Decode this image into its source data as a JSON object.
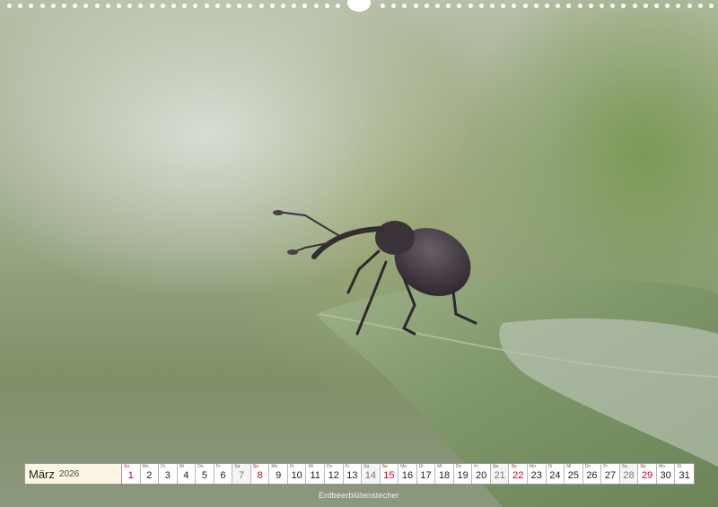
{
  "calendar": {
    "month": "März",
    "year": "2026",
    "days": [
      {
        "dow": "So",
        "num": "1",
        "type": "sun"
      },
      {
        "dow": "Mo",
        "num": "2",
        "type": "work"
      },
      {
        "dow": "Di",
        "num": "3",
        "type": "work"
      },
      {
        "dow": "Mi",
        "num": "4",
        "type": "work"
      },
      {
        "dow": "Do",
        "num": "5",
        "type": "work"
      },
      {
        "dow": "Fr",
        "num": "6",
        "type": "work"
      },
      {
        "dow": "Sa",
        "num": "7",
        "type": "sat"
      },
      {
        "dow": "So",
        "num": "8",
        "type": "sun"
      },
      {
        "dow": "Mo",
        "num": "9",
        "type": "work"
      },
      {
        "dow": "Di",
        "num": "10",
        "type": "work"
      },
      {
        "dow": "Mi",
        "num": "11",
        "type": "work"
      },
      {
        "dow": "Do",
        "num": "12",
        "type": "work"
      },
      {
        "dow": "Fr",
        "num": "13",
        "type": "work"
      },
      {
        "dow": "Sa",
        "num": "14",
        "type": "sat"
      },
      {
        "dow": "So",
        "num": "15",
        "type": "sun"
      },
      {
        "dow": "Mo",
        "num": "16",
        "type": "work"
      },
      {
        "dow": "Di",
        "num": "17",
        "type": "work"
      },
      {
        "dow": "Mi",
        "num": "18",
        "type": "work"
      },
      {
        "dow": "Do",
        "num": "19",
        "type": "work"
      },
      {
        "dow": "Fr",
        "num": "20",
        "type": "work"
      },
      {
        "dow": "Sa",
        "num": "21",
        "type": "sat"
      },
      {
        "dow": "So",
        "num": "22",
        "type": "sun"
      },
      {
        "dow": "Mo",
        "num": "23",
        "type": "work"
      },
      {
        "dow": "Di",
        "num": "24",
        "type": "work"
      },
      {
        "dow": "Mi",
        "num": "25",
        "type": "work"
      },
      {
        "dow": "Do",
        "num": "26",
        "type": "work"
      },
      {
        "dow": "Fr",
        "num": "27",
        "type": "work"
      },
      {
        "dow": "Sa",
        "num": "28",
        "type": "sat"
      },
      {
        "dow": "So",
        "num": "29",
        "type": "sun"
      },
      {
        "dow": "Mo",
        "num": "30",
        "type": "work"
      },
      {
        "dow": "Di",
        "num": "31",
        "type": "work"
      }
    ]
  },
  "caption": "Erdbeerblütenstecher",
  "colors": {
    "sunday_red": "#c8001e",
    "month_bg": "#fbf6e3"
  }
}
